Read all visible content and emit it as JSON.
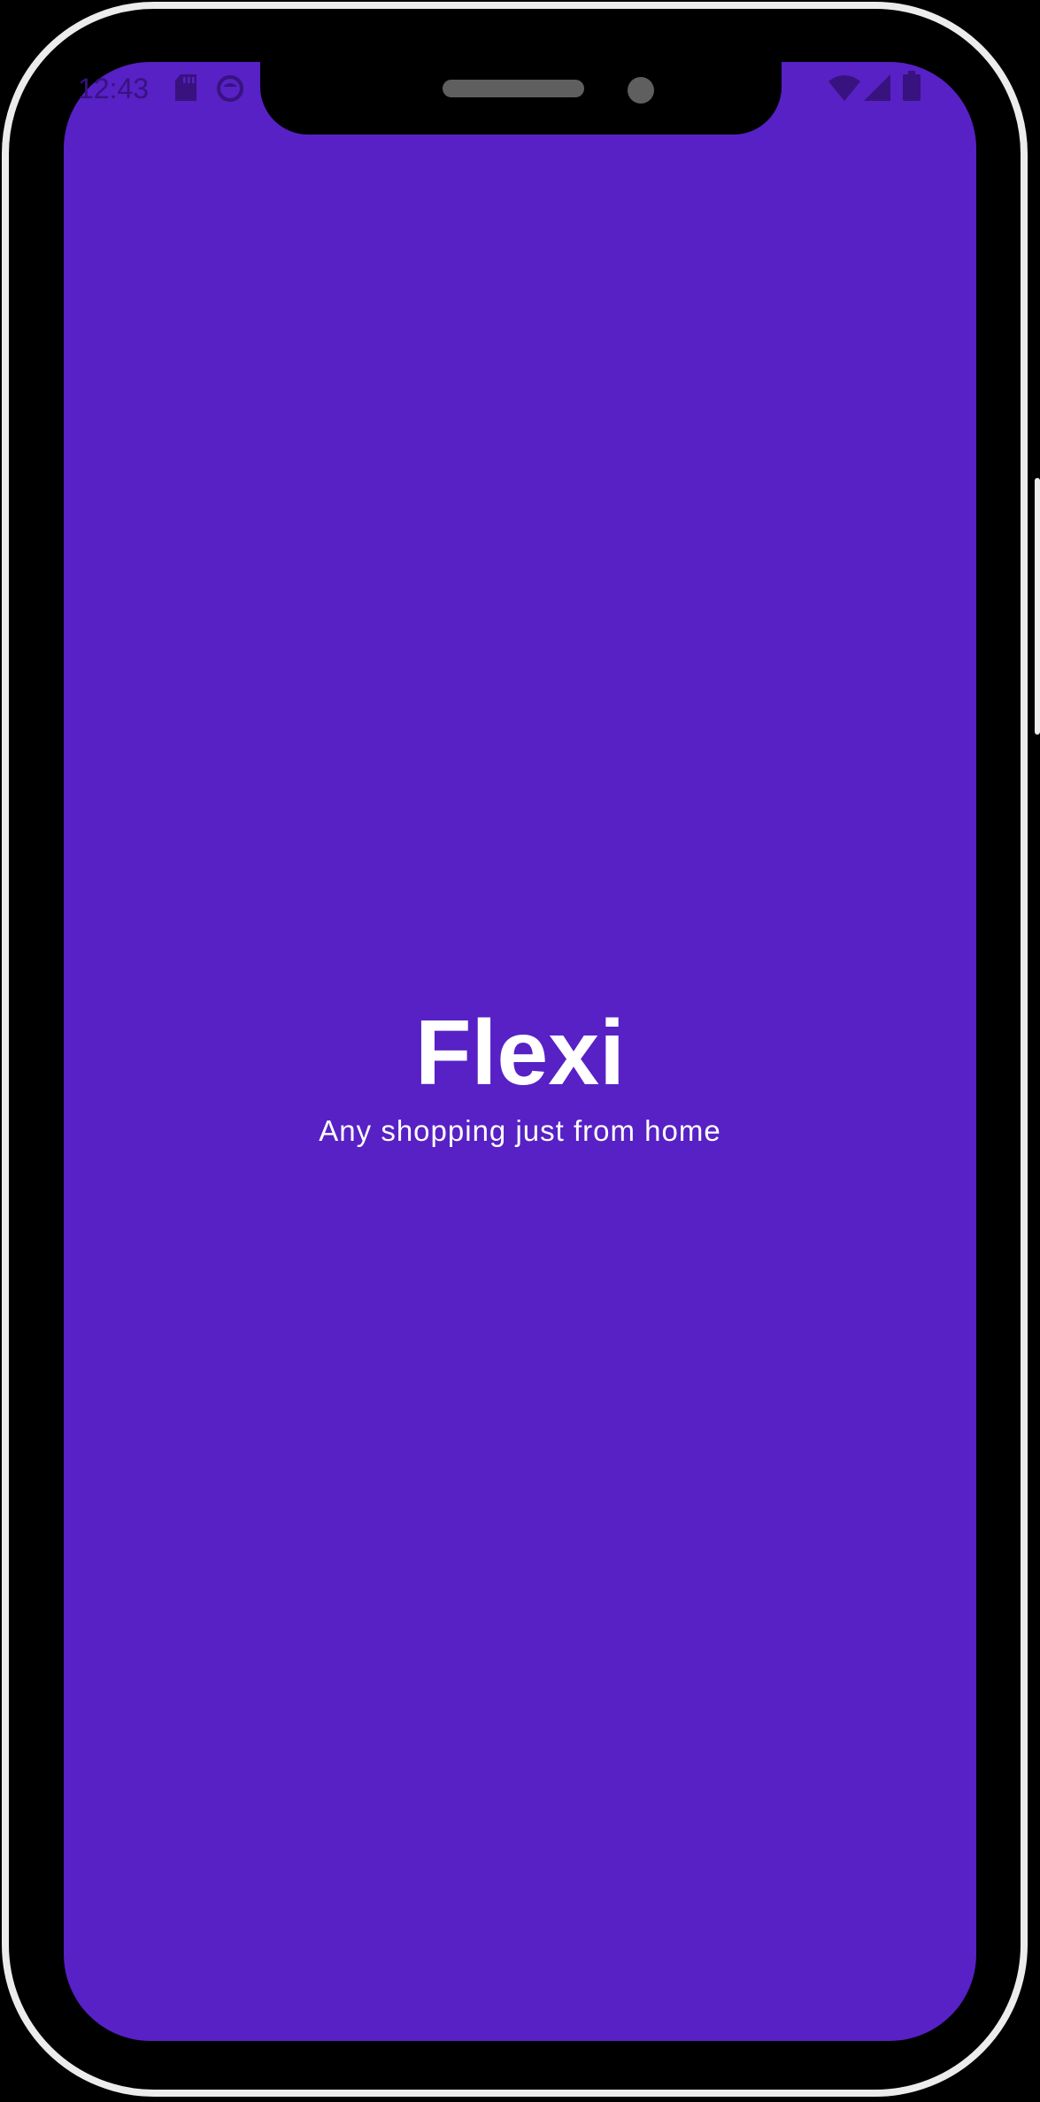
{
  "status_bar": {
    "time": "12:43",
    "left_icons": [
      "sd-card-icon",
      "media-notification-icon"
    ],
    "right_icons": [
      "wifi-icon",
      "cellular-signal-icon",
      "battery-icon"
    ],
    "icon_color": "#38127e"
  },
  "splash": {
    "title": "Flexi",
    "tagline": "Any shopping just from home",
    "background_color": "#5721c5",
    "text_color": "#ffffff"
  }
}
